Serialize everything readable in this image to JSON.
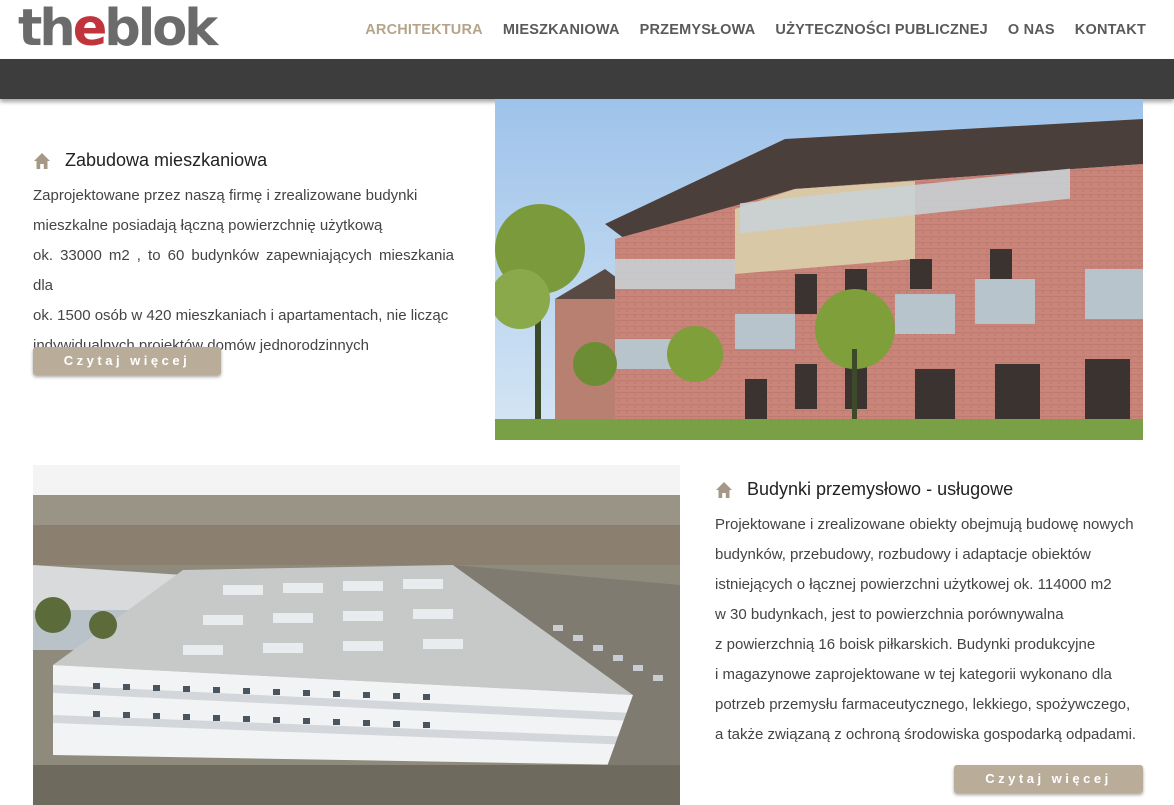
{
  "brand": {
    "logo_pre": "th",
    "logo_accent": "e",
    "logo_post": "blok",
    "accent_color": "#c0343b"
  },
  "nav": {
    "items": [
      {
        "label": "ARCHITEKTURA",
        "active": true
      },
      {
        "label": "MIESZKANIOWA",
        "active": false
      },
      {
        "label": "PRZEMYSŁOWA",
        "active": false
      },
      {
        "label": "UŻYTECZNOŚCI PUBLICZNEJ",
        "active": false
      },
      {
        "label": "O NAS",
        "active": false
      },
      {
        "label": "KONTAKT",
        "active": false
      }
    ],
    "active_color": "#b5a48a"
  },
  "sections": [
    {
      "icon": "house-icon",
      "title": "Zabudowa mieszkaniowa",
      "lines": [
        "Zaprojektowane przez naszą firmę i zrealizowane budynki",
        "mieszkalne posiadają łączną powierzchnię użytkową",
        "ok. 33000 m2 , to 60 budynków zapewniających mieszkania dla",
        "ok. 1500 osób w 420 mieszkaniach i apartamentach, nie licząc",
        "indywidualnych projektów domów jednorodzinnych"
      ],
      "button": "Czytaj więcej"
    },
    {
      "icon": "house-icon",
      "title": "Budynki przemysłowo - usługowe",
      "lines": [
        "Projektowane i zrealizowane obiekty obejmują budowę nowych",
        "budynków, przebudowy, rozbudowy i adaptacje obiektów",
        "istniejących o łącznej powierzchni użytkowej ok. 114000 m2",
        "w 30 budynkach, jest to powierzchnia porównywalna",
        "z powierzchnią 16 boisk piłkarskich. Budynki produkcyjne",
        "i magazynowe zaprojektowane w tej kategorii wykonano dla",
        "potrzeb przemysłu farmaceutycznego, lekkiego, spożywczego,",
        "a także związaną z ochroną środowiska gospodarką odpadami."
      ],
      "button": "Czytaj więcej"
    }
  ],
  "colors": {
    "header_bar": "#3d3d3d",
    "button": "#b9ad99",
    "icon": "#a59886"
  }
}
